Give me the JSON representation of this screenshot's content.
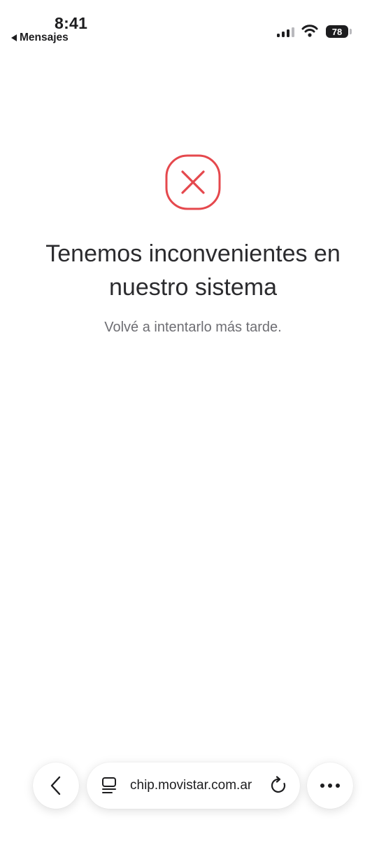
{
  "status_bar": {
    "time": "8:41",
    "back_app": "Mensajes",
    "battery": "78"
  },
  "error": {
    "icon": "x-circle-icon",
    "accent_color": "#e5484d",
    "title_line1": "Tenemos inconvenientes en",
    "title_line2": "nuestro sistema",
    "subtitle": "Volvé a intentarlo más tarde."
  },
  "browser_bar": {
    "url": "chip.movistar.com.ar",
    "back_icon": "chevron-left-icon",
    "tabs_icon": "tabs-icon",
    "reload_icon": "reload-icon",
    "more_icon": "ellipsis-icon"
  }
}
